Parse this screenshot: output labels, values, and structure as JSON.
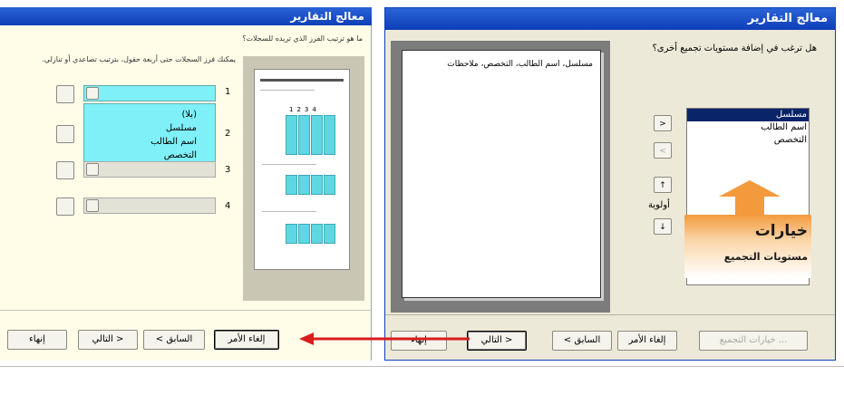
{
  "left_window": {
    "title": "معالج التقارير",
    "question": "ما هو ترتيب الفرز الذي تريده للسجلات؟",
    "instruction": "يمكنك فرز السجلات حتى أربعة حقول، بترتيب تصاعدي أو تنازلي.",
    "sort_levels": [
      {
        "number": "1",
        "value": ""
      },
      {
        "number": "2",
        "value": ""
      },
      {
        "number": "3",
        "value": ""
      },
      {
        "number": "4",
        "value": ""
      }
    ],
    "sort_dropdown_options": [
      "(بلا)",
      "مسلسل",
      "اسم الطالب",
      "التخصص"
    ],
    "buttons": {
      "finish": "إنهاء",
      "next": "التالي >",
      "back": "< السابق",
      "cancel": "إلغاء الأمر"
    }
  },
  "right_window": {
    "title": "معالج التقارير",
    "question": "هل ترغب في إضافة مستويات تجميع أخرى؟",
    "preview_fields": "مسلسل، اسم الطالب، التخصص، ملاحظات",
    "field_list": [
      "مسلسل",
      "اسم الطالب",
      "التخصص"
    ],
    "selected_field": "مسلسل",
    "priority_label": "أولوية",
    "move_buttons": [
      ">",
      "<",
      "↑",
      "↓"
    ],
    "annotation": {
      "title": "خيارات",
      "subtitle": "مستويات التجميع"
    },
    "buttons": {
      "grouping_options": "خيارات التجميع ...",
      "cancel": "إلغاء الأمر",
      "back": "< السابق",
      "next": "التالي >",
      "finish": "إنهاء"
    }
  },
  "colors": {
    "title_bar": "#1f4fc8",
    "panel": "#fffde8",
    "highlight": "#7ff0f8",
    "annotation_arrow": "#f39a3c",
    "pointer_arrow": "#d81d1d"
  }
}
